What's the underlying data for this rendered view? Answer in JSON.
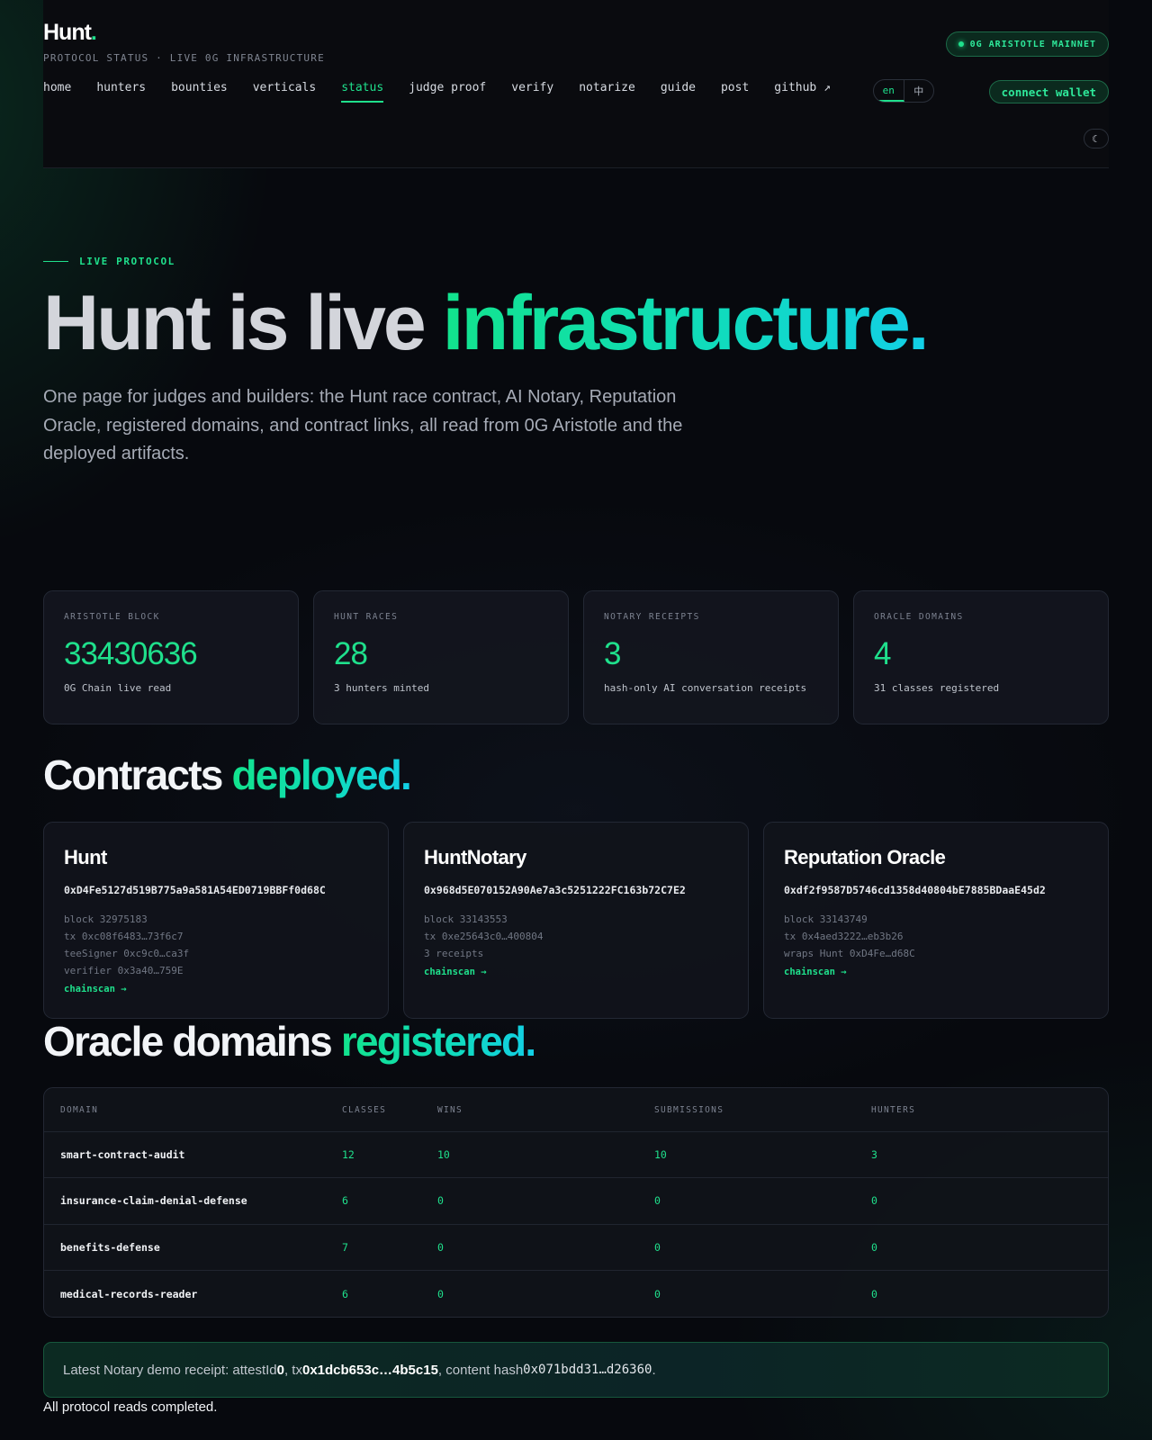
{
  "header": {
    "logo": "Hunt",
    "logo_dot": ".",
    "tagline": "PROTOCOL STATUS · LIVE 0G INFRASTRUCTURE",
    "network_badge": "0G ARISTOTLE MAINNET",
    "nav": [
      {
        "label": "home"
      },
      {
        "label": "hunters"
      },
      {
        "label": "bounties"
      },
      {
        "label": "verticals"
      },
      {
        "label": "status",
        "active": true
      },
      {
        "label": "judge proof"
      },
      {
        "label": "verify"
      },
      {
        "label": "notarize"
      },
      {
        "label": "guide"
      },
      {
        "label": "post"
      },
      {
        "label": "github ↗"
      }
    ],
    "lang": {
      "en": "en",
      "zh": "中"
    },
    "wallet_button": "connect wallet",
    "theme_toggle": "☾"
  },
  "hero": {
    "eyebrow": "LIVE PROTOCOL",
    "title_plain": "Hunt is live ",
    "title_accent": "infrastructure.",
    "description": "One page for judges and builders: the Hunt race contract, AI Notary, Reputation Oracle, registered domains, and contract links, all read from 0G Aristotle and the deployed artifacts."
  },
  "stats": [
    {
      "label": "ARISTOTLE BLOCK",
      "value": "33430636",
      "sub": "0G Chain live read"
    },
    {
      "label": "HUNT RACES",
      "value": "28",
      "sub": "3 hunters minted"
    },
    {
      "label": "NOTARY RECEIPTS",
      "value": "3",
      "sub": "hash-only AI conversation receipts"
    },
    {
      "label": "ORACLE DOMAINS",
      "value": "4",
      "sub": "31 classes registered"
    }
  ],
  "contracts_section": {
    "title_plain": "Contracts ",
    "title_accent": "deployed."
  },
  "contracts": [
    {
      "name": "Hunt",
      "address": "0xD4Fe5127d519B775a9a581A54ED0719BBFf0d68C",
      "meta": [
        "block 32975183",
        "tx 0xc08f6483…73f6c7",
        "teeSigner 0xc9c0…ca3f",
        "verifier 0x3a40…759E"
      ],
      "link": "chainscan →"
    },
    {
      "name": "HuntNotary",
      "address": "0x968d5E070152A90Ae7a3c5251222FC163b72C7E2",
      "meta": [
        "block 33143553",
        "tx 0xe25643c0…400804",
        "3 receipts"
      ],
      "link": "chainscan →"
    },
    {
      "name": "Reputation Oracle",
      "address": "0xdf2f9587D5746cd1358d40804bE7885BDaaE45d2",
      "meta": [
        "block 33143749",
        "tx 0x4aed3222…eb3b26",
        "wraps Hunt 0xD4Fe…d68C"
      ],
      "link": "chainscan →"
    }
  ],
  "oracle_section": {
    "title_plain": "Oracle domains ",
    "title_accent": "registered."
  },
  "domains_table": {
    "columns": [
      "DOMAIN",
      "CLASSES",
      "WINS",
      "SUBMISSIONS",
      "HUNTERS"
    ],
    "rows": [
      {
        "domain": "smart-contract-audit",
        "classes": "12",
        "wins": "10",
        "submissions": "10",
        "hunters": "3"
      },
      {
        "domain": "insurance-claim-denial-defense",
        "classes": "6",
        "wins": "0",
        "submissions": "0",
        "hunters": "0"
      },
      {
        "domain": "benefits-defense",
        "classes": "7",
        "wins": "0",
        "submissions": "0",
        "hunters": "0"
      },
      {
        "domain": "medical-records-reader",
        "classes": "6",
        "wins": "0",
        "submissions": "0",
        "hunters": "0"
      }
    ]
  },
  "receipt": {
    "prefix": "Latest Notary demo receipt: attestId ",
    "attest_id": "0",
    "tx_label": ", tx ",
    "tx": "0x1dcb653c…4b5c15",
    "hash_label": ", content hash ",
    "hash": "0x071bdd31…d26360",
    "suffix": "."
  },
  "footer_note": "All protocol reads completed."
}
